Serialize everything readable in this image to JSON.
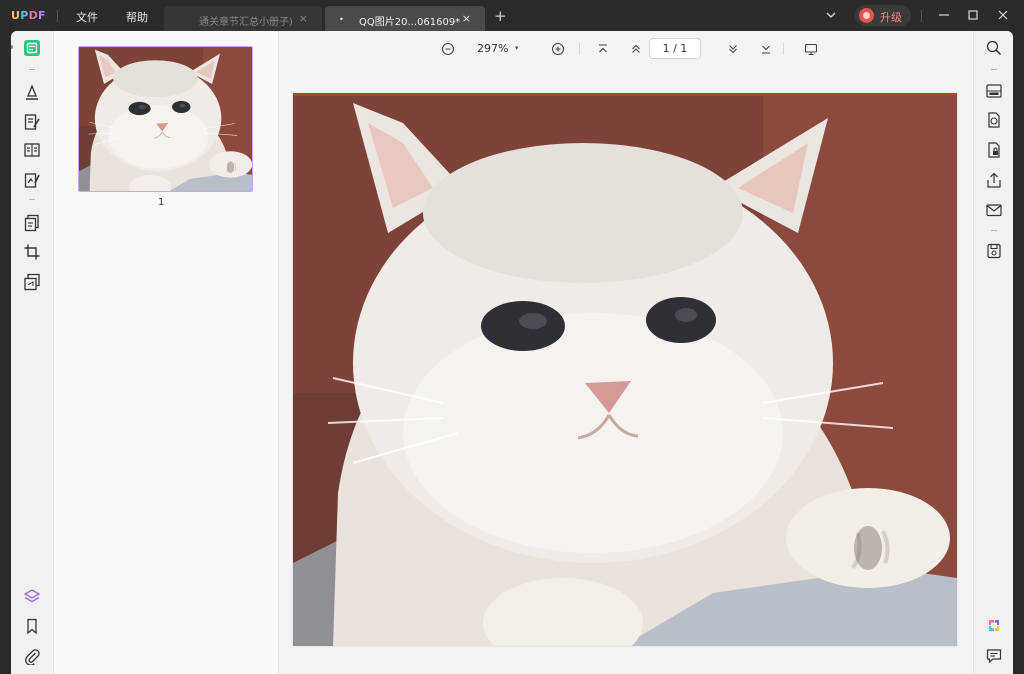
{
  "app": {
    "logo": {
      "u": "U",
      "p": "P",
      "d": "D",
      "f": "F"
    },
    "menu": {
      "file": "文件",
      "help": "帮助"
    },
    "tabs": [
      {
        "title": "通关章节汇总小册子)",
        "dot": "*",
        "close": "×"
      },
      {
        "title": "QQ图片20...061609*",
        "dot": "•",
        "close": "×"
      }
    ],
    "add_tab": "+",
    "upgrade_label": "升级"
  },
  "toolbar": {
    "zoom": "297%",
    "zoom_caret": "▾",
    "page_current": "1",
    "page_sep": "/",
    "page_total": "1"
  },
  "thumbnails": [
    {
      "number": "1"
    }
  ],
  "colors": {
    "accent_green": "#2ec27e",
    "accent_purple": "#a36bf0",
    "upgrade_red": "#e8554e"
  }
}
